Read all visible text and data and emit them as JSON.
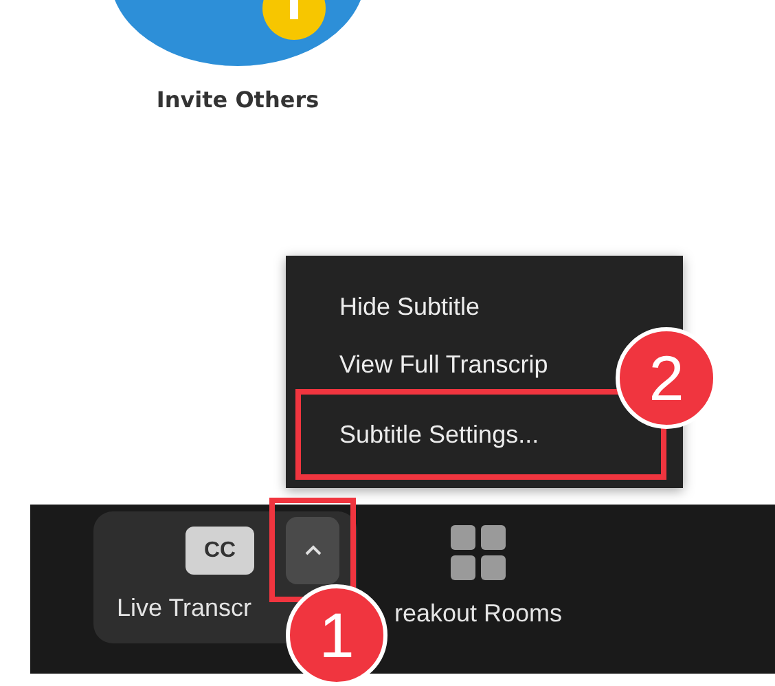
{
  "invite": {
    "label": "Invite Others"
  },
  "menu": {
    "items": [
      {
        "label": "Hide Subtitle",
        "highlighted": false
      },
      {
        "label": "View Full Transcrip",
        "highlighted": false
      },
      {
        "label": "Subtitle Settings...",
        "highlighted": true
      }
    ]
  },
  "toolbar": {
    "buttons": [
      {
        "kind": "captions",
        "icon_text": "CC",
        "label": "Live Transcr",
        "active": true
      },
      {
        "kind": "grid",
        "label": "reakout Rooms",
        "active": false
      }
    ],
    "menu_toggle": {
      "highlighted": true
    }
  },
  "callouts": [
    {
      "number": "1"
    },
    {
      "number": "2"
    }
  ]
}
